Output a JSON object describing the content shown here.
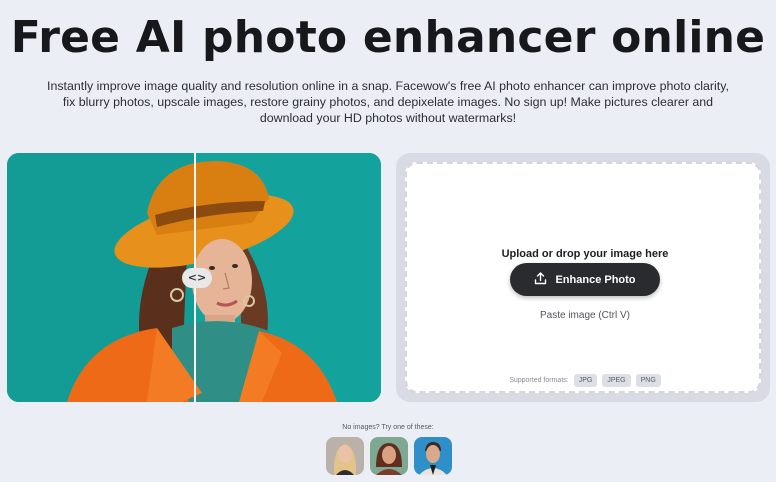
{
  "header": {
    "title": "Free AI photo enhancer online",
    "description": "Instantly improve image quality and resolution online in a snap. Facewow's free AI photo enhancer can improve photo clarity, fix blurry photos, upscale images, restore grainy photos, and depixelate images. No sign up! Make pictures clearer and download your HD photos without watermarks!"
  },
  "compare": {
    "handle_label": "<>",
    "background_color": "#14a39c",
    "hat_color": "#e8901c",
    "coat_color": "#ee6a16"
  },
  "upload": {
    "prompt": "Upload or drop your image here",
    "button_label": "Enhance Photo",
    "button_icon": "upload-icon",
    "paste_label": "Paste image (Ctrl V)",
    "formats_label": "Supported formats:",
    "formats": [
      "JPG",
      "JPEG",
      "PNG"
    ]
  },
  "samples": {
    "label": "No images? Try one of these:",
    "items": [
      "sample-blonde-woman",
      "sample-woman-green",
      "sample-man-suit"
    ]
  }
}
